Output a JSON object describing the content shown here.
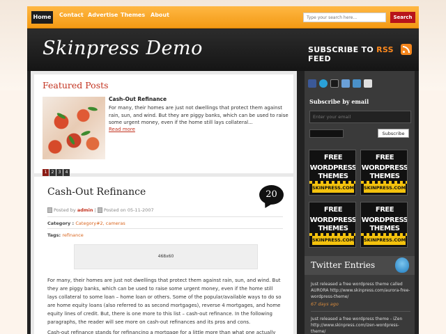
{
  "nav": {
    "items": [
      "Home",
      "Contact",
      "Advertise",
      "Themes",
      "About"
    ],
    "search_placeholder": "Type your search here...",
    "search_button": "Search"
  },
  "header": {
    "title": "Skinpress Demo",
    "subscribe_prefix": "SUBSCRIBE TO",
    "subscribe_rss": "RSS",
    "subscribe_suffix": "FEED"
  },
  "featured": {
    "heading": "Featured Posts",
    "post_title": "Cash-Out Refinance",
    "excerpt": "For many, their homes are just not dwellings that protect them against rain, sun, and wind. But they are piggy banks, which can be used to raise some urgent money, even if the home still lays collateral...",
    "read_more": "Read more",
    "pages": [
      "1",
      "2",
      "3",
      "4"
    ]
  },
  "post": {
    "title": "Cash-Out Refinance",
    "comments": "20",
    "posted_by_label": "Posted by",
    "author": "admin",
    "posted_on_label": "Posted on",
    "date": "05-11-2007",
    "category_label": "Category :",
    "categories": "Category#2, cameras",
    "tags_label": "Tags:",
    "tags": "refinance",
    "ad_label": "468x60",
    "p1": "For many, their homes are just not dwellings that protect them against rain, sun, and wind. But they are piggy banks, which can be used to raise some urgent money, even if the home still lays collateral to some loan – home loan or others. Some of the popular/available ways to do so are home equity loans (also referred to as second mortgages), reverse 4 mortgages, and home equity lines of credit. But, there is one more to this list – cash-out refinance. In the following paragraphs, the reader will see more on cash-out refinances and its pros and cons.",
    "p2": "Cash-out refinance stands for refinancing a mortgage for a little more than what one actually owes so that"
  },
  "sidebar": {
    "subscribe_heading": "Subscribe by email",
    "email_placeholder": "Enter your email",
    "subscribe_button": "Subscribe",
    "ads": [
      {
        "l1": "FREE",
        "l2": "WORDPRESS",
        "l2b": "THEMES",
        "l3": "SKINPRESS.COM"
      },
      {
        "l1": "FREE",
        "l2": "WORDPRESS",
        "l2b": "THEMES",
        "l3": "SKINPRESS.COM"
      },
      {
        "l1": "FREE",
        "l2": "WORDPRESS",
        "l2b": "THEMES",
        "l3": "SKINPRESS.COM"
      },
      {
        "l1": "FREE",
        "l2": "WORDPRESS",
        "l2b": "THEMES",
        "l3": "SKINPRESS.COM"
      }
    ],
    "twitter_heading": "Twitter Entries",
    "tweets": [
      {
        "text": "Just released a free wordpress theme called AURORA http://www.skinpress.com/aurora-free-wordpress-theme/",
        "time": "67 days ago"
      },
      {
        "text": "Just released a free wordpress theme - iZen http://www.skinpress.com/izen-wordpress-theme/",
        "time": ""
      }
    ],
    "social_colors": [
      "#3b5998",
      "#2aa1d8",
      "#1a1a1a",
      "#6aa0d8",
      "#4a90c8",
      "#e0e0e0"
    ]
  }
}
